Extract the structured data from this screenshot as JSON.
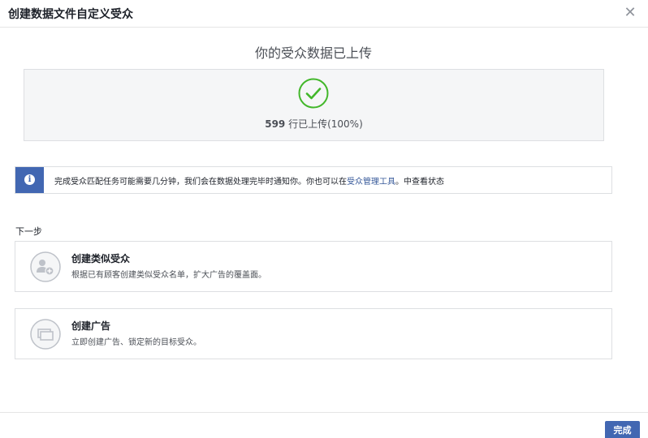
{
  "dialog": {
    "title": "创建数据文件自定义受众",
    "close_icon": "close-icon"
  },
  "upload": {
    "heading": "你的受众数据已上传",
    "count": "599",
    "status_text": " 行已上传(100%)",
    "icon": "check-circle-icon",
    "accent_color": "#42b72a"
  },
  "info": {
    "icon": "info-icon",
    "text_before": "完成受众匹配任务可能需要几分钟，我们会在数据处理完毕时通知你。你也可以在",
    "link_text": "受众管理工具",
    "text_after": "。中查看状态"
  },
  "next_steps": {
    "label": "下一步",
    "items": [
      {
        "title": "创建类似受众",
        "description": "根据已有顾客创建类似受众名单，扩大广告的覆盖面。",
        "icon": "lookalike-audience-icon"
      },
      {
        "title": "创建广告",
        "description": "立即创建广告、锁定新的目标受众。",
        "icon": "create-ad-icon"
      }
    ]
  },
  "footer": {
    "done_label": "完成",
    "button_color": "#4267b2"
  }
}
